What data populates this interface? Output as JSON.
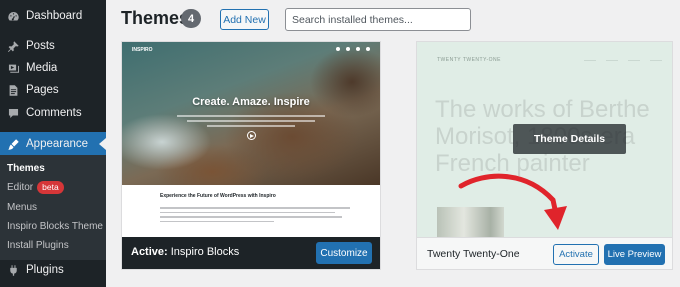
{
  "sidebar": {
    "items": [
      {
        "label": "Dashboard",
        "icon": "dashboard-icon"
      },
      {
        "label": "Posts",
        "icon": "pin-icon"
      },
      {
        "label": "Media",
        "icon": "media-icon"
      },
      {
        "label": "Pages",
        "icon": "page-icon"
      },
      {
        "label": "Comments",
        "icon": "comment-icon"
      },
      {
        "label": "Appearance",
        "icon": "brush-icon"
      },
      {
        "label": "Plugins",
        "icon": "plugin-icon"
      }
    ],
    "submenu": [
      {
        "label": "Themes"
      },
      {
        "label": "Editor",
        "badge": "beta"
      },
      {
        "label": "Menus"
      },
      {
        "label": "Inspiro Blocks Theme"
      },
      {
        "label": "Install Plugins"
      }
    ]
  },
  "header": {
    "title": "Themes",
    "count": "4",
    "add_new_label": "Add New",
    "search_placeholder": "Search installed themes..."
  },
  "themes": [
    {
      "name": "Inspiro Blocks",
      "active_prefix": "Active:",
      "customize_label": "Customize",
      "preview": {
        "logo": "INSPIRO",
        "hero": "Create. Amaze. Inspire",
        "subheading": "Experience the Future of WordPress with Inspiro"
      }
    },
    {
      "name": "Twenty Twenty-One",
      "details_label": "Theme Details",
      "activate_label": "Activate",
      "live_preview_label": "Live Preview",
      "preview": {
        "logo": "TWENTY TWENTY-ONE",
        "headline": "The works of Berthe Morisot, 1800s-era French painter"
      }
    }
  ],
  "colors": {
    "sidebar_bg": "#1d2327",
    "accent": "#2271b1",
    "badge_red": "#d63638",
    "annotation_arrow": "#e0242b"
  }
}
